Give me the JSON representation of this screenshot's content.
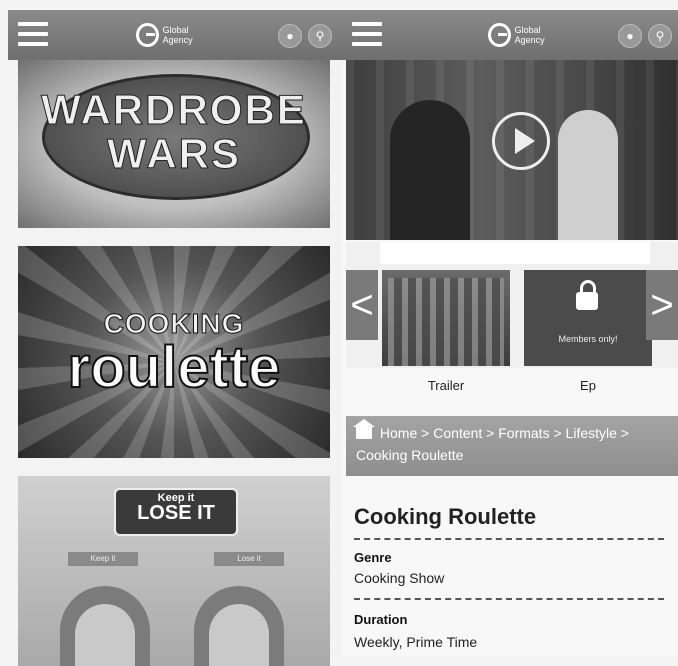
{
  "left_header": {
    "logo_text": "Global Agency",
    "menu_icon": "hamburger-icon",
    "user_icon": "user-icon",
    "search_icon": "search-icon"
  },
  "right_header": {
    "logo_text": "Global Agency",
    "menu_icon": "hamburger-icon",
    "user_icon": "user-icon",
    "search_icon": "search-icon"
  },
  "left_panel": {
    "shows": [
      {
        "line1": "WARDROBE",
        "line2": "WARS"
      },
      {
        "line1": "COOKING",
        "line2": "roulette"
      },
      {
        "line1": "Keep it",
        "line2": "LOSE IT",
        "tag1": "Keep it",
        "tag2": "Lose it"
      }
    ]
  },
  "player": {
    "play_icon": "play-icon"
  },
  "episodes": {
    "prev_arrow": "<",
    "next_arrow": ">",
    "items": [
      {
        "label": "Trailer"
      },
      {
        "label": "Ep",
        "locked_text": "Members only!"
      }
    ]
  },
  "breadcrumb": {
    "items": [
      "Home",
      "Content",
      "Formats",
      "Lifestyle",
      "Cooking Roulette"
    ],
    "separator": ">"
  },
  "details": {
    "title": "Cooking Roulette",
    "genre_label": "Genre",
    "genre_value": "Cooking Show",
    "duration_label": "Duration",
    "duration_value": "Weekly, Prime Time"
  }
}
